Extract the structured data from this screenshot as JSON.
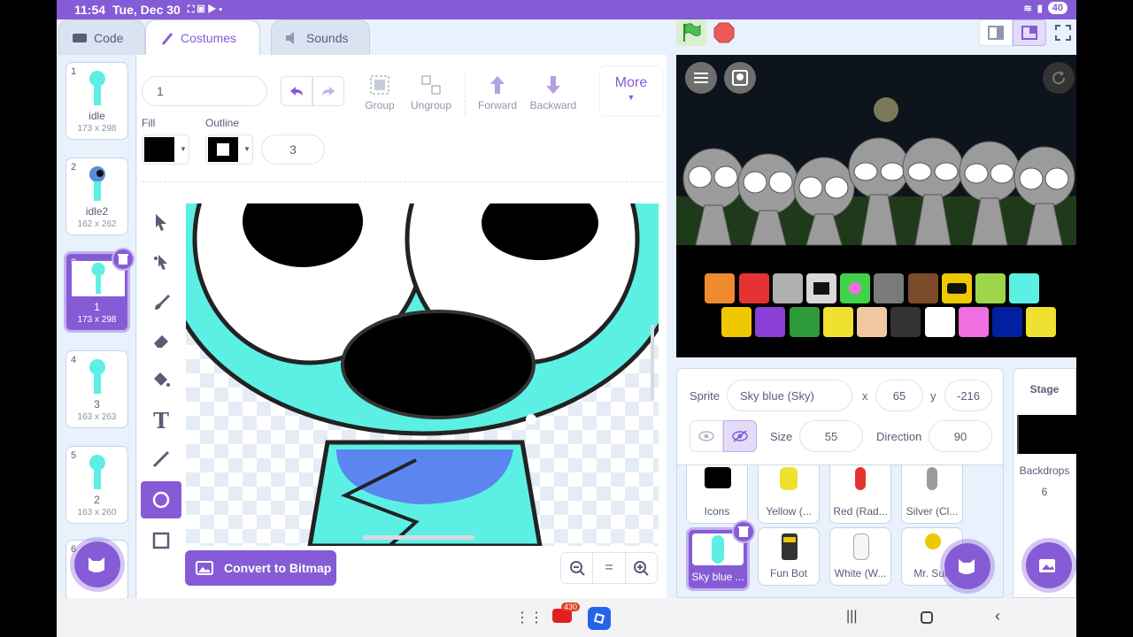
{
  "status": {
    "time": "11:54",
    "date": "Tue, Dec 30",
    "battery": "40"
  },
  "tabs": [
    {
      "label": "Code",
      "icon": "code-icon"
    },
    {
      "label": "Costumes",
      "icon": "brush-icon"
    },
    {
      "label": "Sounds",
      "icon": "speaker-icon"
    }
  ],
  "costumes": [
    {
      "num": "1",
      "name": "idle",
      "size": "173 x 298"
    },
    {
      "num": "2",
      "name": "idle2",
      "size": "162 x 262"
    },
    {
      "num": "3",
      "name": "1",
      "size": "173 x 298"
    },
    {
      "num": "4",
      "name": "3",
      "size": "163 x 263"
    },
    {
      "num": "5",
      "name": "2",
      "size": "163 x 260"
    },
    {
      "num": "6",
      "name": "",
      "size": ""
    }
  ],
  "editor": {
    "costume_name": "1",
    "group": "Group",
    "ungroup": "Ungroup",
    "forward": "Forward",
    "backward": "Backward",
    "more": "More",
    "fill_label": "Fill",
    "outline_label": "Outline",
    "outline_width": "3",
    "convert": "Convert to Bitmap",
    "zoom_reset": "="
  },
  "sprite_info": {
    "sprite_label": "Sprite",
    "sprite_name": "Sky blue (Sky)",
    "x_label": "x",
    "x": "65",
    "y_label": "y",
    "y": "-216",
    "size_label": "Size",
    "size": "55",
    "direction_label": "Direction",
    "direction": "90"
  },
  "sprites": [
    {
      "name": "Icons"
    },
    {
      "name": "Yellow (..."
    },
    {
      "name": "Red (Rad..."
    },
    {
      "name": "Silver (Cl..."
    },
    {
      "name": "Sky blue ..."
    },
    {
      "name": "Fun Bot"
    },
    {
      "name": "White (W..."
    },
    {
      "name": "Mr. Sun"
    }
  ],
  "stage_pane": {
    "title": "Stage",
    "backdrops_label": "Backdrops",
    "backdrops_count": "6"
  },
  "nav": {
    "badge": "430"
  },
  "colors": {
    "accent": "#855cd6",
    "character": "#5cf0e4",
    "stage_bg": "#000000"
  }
}
